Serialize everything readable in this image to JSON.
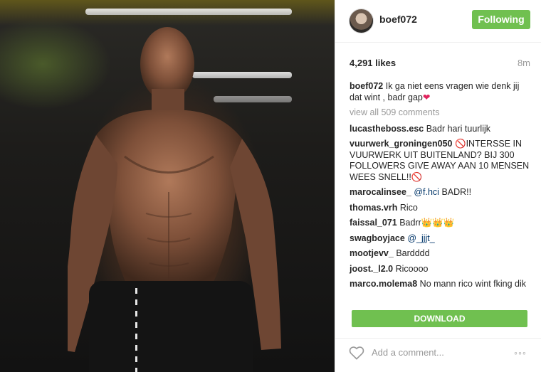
{
  "post": {
    "username": "boef072",
    "follow_label": "Following",
    "likes": "4,291 likes",
    "age": "8m",
    "caption": {
      "username": "boef072",
      "text": "Ik ga niet eens vragen wie denk jij dat wint , badr gap",
      "emoji": "❤"
    },
    "view_all": "view all 509 comments"
  },
  "comments": [
    {
      "user": "lucastheboss.esc",
      "text": "Badr hari tuurlijk"
    },
    {
      "user": "vuurwerk_groningen050",
      "emoji_before": "🚫",
      "text": "INTERSSE IN VUURWERK UIT BUITENLAND? BIJ 300 FOLLOWERS GIVE AWAY AAN 10 MENSEN WEES SNELL!!",
      "emoji_after": "🚫"
    },
    {
      "user": "marocalinsee_",
      "mention": "@f.hci",
      "text": "BADR!!"
    },
    {
      "user": "thomas.vrh",
      "text": "Rico"
    },
    {
      "user": "faissal_071",
      "text": "Badrr",
      "emoji_after": "👑👑👑"
    },
    {
      "user": "swagboyjace",
      "mention": "@_jjjt_",
      "text": ""
    },
    {
      "user": "mootjevv_",
      "text": "Bardddd"
    },
    {
      "user": "joost._l2.0",
      "text": "Ricoooo"
    },
    {
      "user": "marco.molema8",
      "text": "No mann rico wint fking dik"
    }
  ],
  "download_label": "DOWNLOAD",
  "add_comment_placeholder": "Add a comment...",
  "icons": {
    "like": "heart-outline-icon",
    "more": "more-options-icon",
    "avatar": "profile-avatar"
  },
  "colors": {
    "accent_green": "#70c050",
    "mention_blue": "#003569",
    "muted": "#999999"
  }
}
